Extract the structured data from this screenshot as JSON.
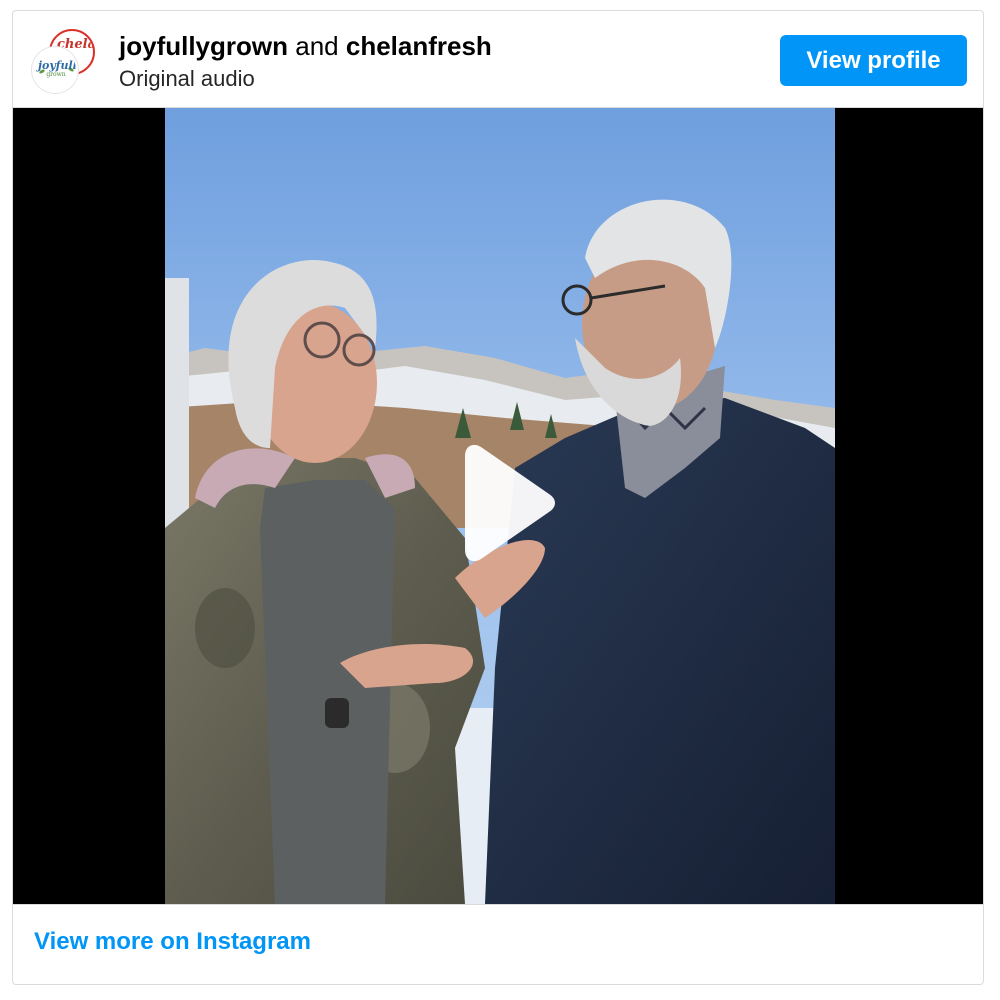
{
  "header": {
    "author_primary": "joyfullygrown",
    "conjunction": "and",
    "author_secondary": "chelanfresh",
    "audio_label": "Original audio",
    "view_profile_label": "View profile",
    "avatar_back_text": "chelan",
    "avatar_front_text": "joyfully",
    "avatar_front_subtext": "grown"
  },
  "video": {
    "play_icon": "play-icon"
  },
  "footer": {
    "link_label": "View more on Instagram"
  },
  "colors": {
    "accent": "#0095f6",
    "border": "#dbdbdb",
    "video_letterbox": "#000000"
  }
}
